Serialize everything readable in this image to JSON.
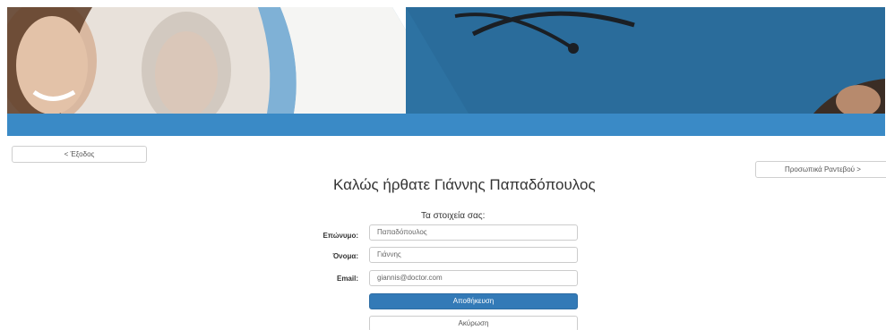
{
  "nav": {
    "exit_label": "< Έξοδος",
    "appointments_label": "Προσωπικά Ραντεβού >"
  },
  "welcome": {
    "title": "Καλώς ήρθατε Γιάννης Παπαδόπουλος"
  },
  "form": {
    "heading": "Τα στοιχεία σας:",
    "fields": [
      {
        "label": "Επώνυμο:",
        "value": "Παπαδόπουλος"
      },
      {
        "label": "Όνομα:",
        "value": "Γιάννης"
      },
      {
        "label": "Email:",
        "value": "giannis@doctor.com"
      }
    ],
    "save_label": "Αποθήκευση",
    "cancel_label": "Ακύρωση"
  },
  "colors": {
    "header_bar": "#3a8ac6",
    "primary_button": "#337ab7"
  }
}
